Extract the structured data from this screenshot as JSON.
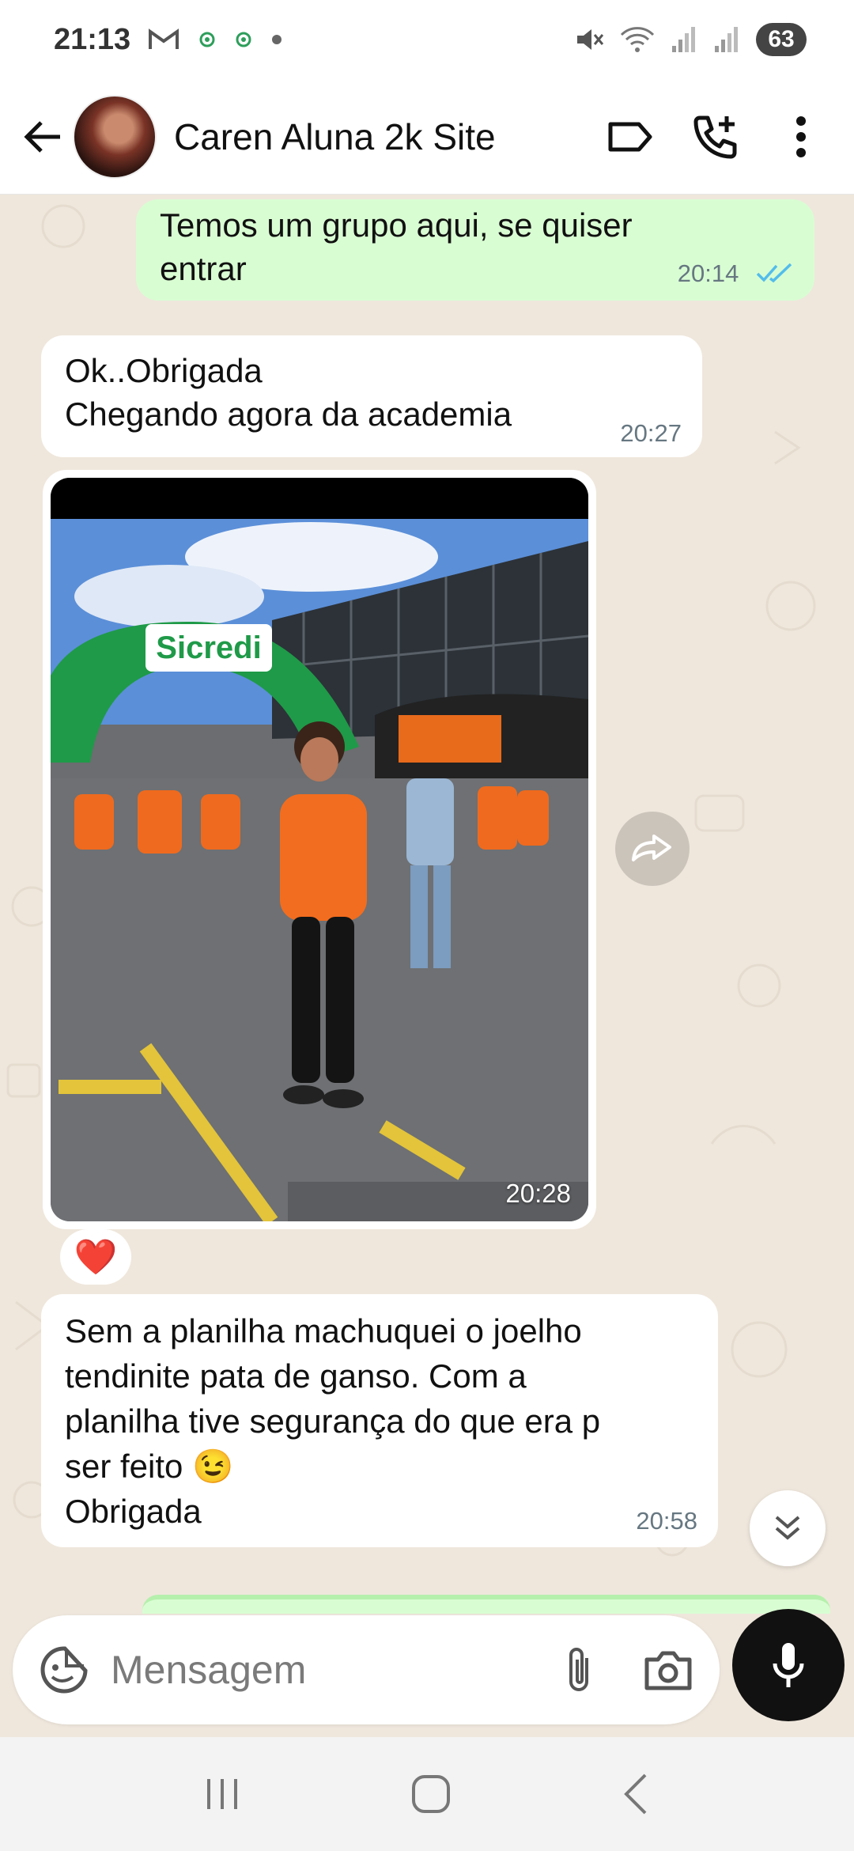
{
  "status_bar": {
    "time": "21:13",
    "battery": "63",
    "left_icons": [
      "gmail-icon",
      "location-dot-icon",
      "location-dot-icon",
      "dot-icon"
    ],
    "right_icons": [
      "mute-icon",
      "wifi-icon",
      "signal-icon",
      "signal-icon"
    ]
  },
  "header": {
    "contact_name": "Caren Aluna 2k Site",
    "icons": [
      "back-arrow-icon",
      "label-icon",
      "add-call-icon",
      "more-vert-icon"
    ]
  },
  "messages": [
    {
      "direction": "out",
      "text_line1": "Temos um grupo aqui, se quiser",
      "text_line2": "entrar",
      "time": "20:14",
      "status": "read"
    },
    {
      "direction": "in",
      "text_line1": "Ok..Obrigada",
      "text_line2": "Chegando agora  da academia",
      "time": "20:27"
    },
    {
      "direction": "in",
      "type": "image",
      "banner_text": "Sicredi",
      "time": "20:28",
      "reaction": "❤️"
    },
    {
      "direction": "in",
      "text_line1": "Sem a planilha machuquei o joelho",
      "text_line2": "tendinite pata de ganso. Com a",
      "text_line3": "planilha tive segurança  do que  era p",
      "text_line4": "ser feito 😉",
      "text_line5": "Obrigada",
      "time": "20:58"
    }
  ],
  "input": {
    "placeholder": "Mensagem"
  },
  "colors": {
    "outgoing_bubble": "#d9fdd3",
    "incoming_bubble": "#ffffff",
    "chat_background": "#efe7dc",
    "read_ticks": "#53bdeb"
  }
}
